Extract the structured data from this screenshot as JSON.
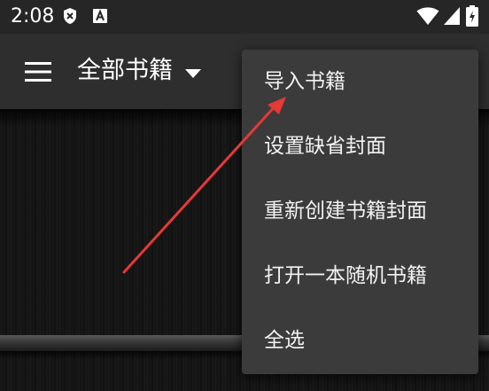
{
  "status_bar": {
    "time": "2:08",
    "icons": [
      "shield-x-icon",
      "a-badge-icon",
      "wifi-icon",
      "signal-icon",
      "battery-icon"
    ]
  },
  "app_bar": {
    "title": "全部书籍",
    "icons": [
      "menu-icon",
      "dropdown-caret-icon"
    ]
  },
  "overflow_menu": {
    "items": [
      {
        "label": "导入书籍"
      },
      {
        "label": "设置缺省封面"
      },
      {
        "label": "重新创建书籍封面"
      },
      {
        "label": "打开一本随机书籍"
      },
      {
        "label": "全选"
      }
    ]
  },
  "colors": {
    "status_bar": "#262626",
    "app_bar": "#2e2e2e",
    "menu_background": "#3b3b3b",
    "annotation_arrow": "#e53935"
  }
}
